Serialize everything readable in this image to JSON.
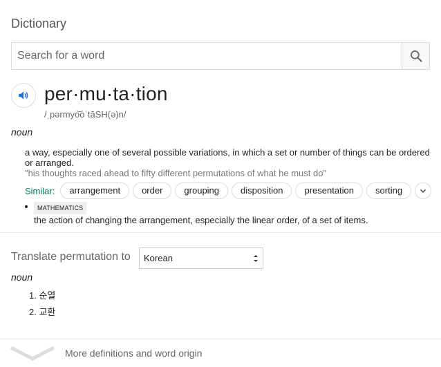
{
  "header": {
    "title": "Dictionary"
  },
  "search": {
    "placeholder": "Search for a word"
  },
  "entry": {
    "headword": "per·mu·ta·tion",
    "phonetic": "/ˌpərmyo͝oˈtāSH(ə)n/",
    "part_of_speech": "noun",
    "definitions": [
      {
        "text": "a way, especially one of several possible variations, in which a set or number of things can be ordered or arranged.",
        "example": "\"his thoughts raced ahead to fifty different permutations of what he must do\"",
        "similar_label": "Similar:",
        "similar": [
          "arrangement",
          "order",
          "grouping",
          "disposition",
          "presentation",
          "sorting"
        ]
      },
      {
        "domain_tag": "MATHEMATICS",
        "text": "the action of changing the arrangement, especially the linear order, of a set of items."
      }
    ]
  },
  "translate": {
    "label": "Translate permutation to",
    "language": "Korean",
    "part_of_speech": "noun",
    "items": [
      {
        "num": "1.",
        "text": "순열"
      },
      {
        "num": "2.",
        "text": "교환"
      }
    ]
  },
  "footer": {
    "more_label": "More definitions and word origin"
  },
  "colors": {
    "similar_label": "#0a7c5c",
    "audio_icon": "#1a73e8",
    "chip_border": "#dadce0"
  },
  "icons": {
    "search": "search-icon",
    "audio": "speaker-icon",
    "expand": "chevron-down-icon"
  }
}
